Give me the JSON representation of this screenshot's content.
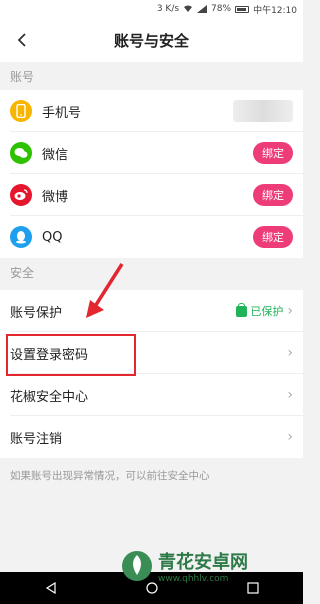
{
  "status": {
    "speed": "3 K/s",
    "battery": "78%",
    "time": "中午12:10"
  },
  "header": {
    "title": "账号与安全"
  },
  "sections": {
    "account": "账号",
    "security": "安全"
  },
  "accounts": [
    {
      "label": "手机号",
      "icon": "phone-icon"
    },
    {
      "label": "微信",
      "icon": "wechat-icon",
      "action": "绑定"
    },
    {
      "label": "微博",
      "icon": "weibo-icon",
      "action": "绑定"
    },
    {
      "label": "QQ",
      "icon": "qq-icon",
      "action": "绑定"
    }
  ],
  "security_items": [
    {
      "label": "账号保护",
      "status": "已保护"
    },
    {
      "label": "设置登录密码"
    },
    {
      "label": "花椒安全中心"
    },
    {
      "label": "账号注销"
    }
  ],
  "note": "如果账号出现异常情况，可以前往安全中心",
  "watermark": {
    "name": "青花安卓网",
    "url": "www.qhhlv.com"
  },
  "colors": {
    "accent": "#ee3c79",
    "green": "#21b35a",
    "highlight": "#e3262f"
  }
}
